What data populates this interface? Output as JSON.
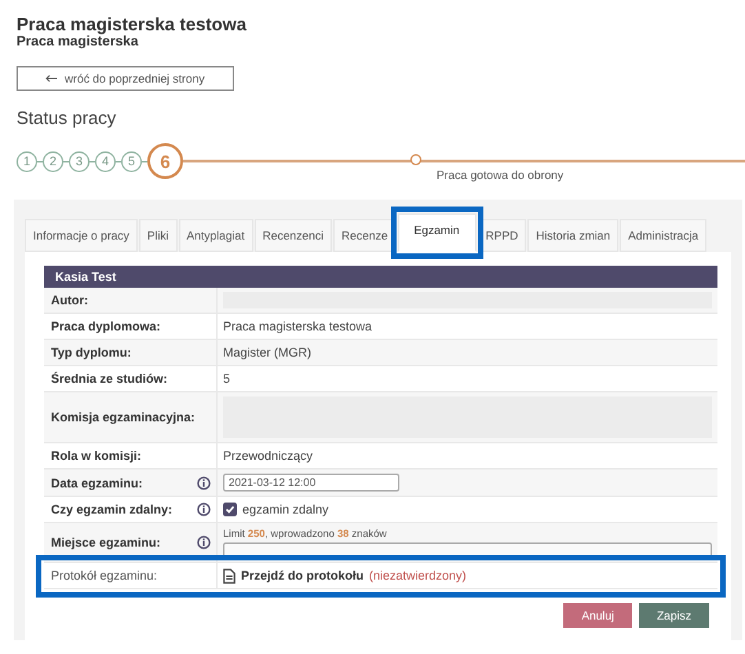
{
  "header": {
    "title": "Praca magisterska testowa",
    "subtitle": "Praca magisterska"
  },
  "back_button": {
    "label": "wróć do poprzedniej strony"
  },
  "status": {
    "heading": "Status pracy",
    "steps": [
      {
        "label": "1",
        "current": false
      },
      {
        "label": "2",
        "current": false
      },
      {
        "label": "3",
        "current": false
      },
      {
        "label": "4",
        "current": false
      },
      {
        "label": "5",
        "current": false
      },
      {
        "label": "6",
        "current": true
      }
    ],
    "milestone": "Praca gotowa do obrony"
  },
  "tabs": [
    {
      "label": "Informacje o pracy",
      "selected": false,
      "highlighted": false
    },
    {
      "label": "Pliki",
      "selected": false,
      "highlighted": false
    },
    {
      "label": "Antyplagiat",
      "selected": false,
      "highlighted": false
    },
    {
      "label": "Recenzenci",
      "selected": false,
      "highlighted": false
    },
    {
      "label": "Recenze",
      "selected": false,
      "highlighted": false
    },
    {
      "label": "Egzamin",
      "selected": true,
      "highlighted": true
    },
    {
      "label": "RPPD",
      "selected": false,
      "highlighted": false
    },
    {
      "label": "Historia zmian",
      "selected": false,
      "highlighted": false
    },
    {
      "label": "Administracja",
      "selected": false,
      "highlighted": false
    }
  ],
  "table": {
    "title": "Kasia Test",
    "rows": [
      {
        "label": "Autor:",
        "kind": "redacted",
        "info": false,
        "highlighted": false
      },
      {
        "label": "Praca dyplomowa:",
        "kind": "text",
        "value": "Praca magisterska testowa",
        "info": false,
        "highlighted": false
      },
      {
        "label": "Typ dyplomu:",
        "kind": "text",
        "value": "Magister (MGR)",
        "info": false,
        "highlighted": false
      },
      {
        "label": "Średnia ze studiów:",
        "kind": "text",
        "value": "5",
        "info": false,
        "highlighted": false
      },
      {
        "label": "Komisja egzaminacyjna:",
        "kind": "redacted_tall",
        "info": false,
        "highlighted": false
      },
      {
        "label": "Rola w komisji:",
        "kind": "text",
        "value": "Przewodniczący",
        "info": false,
        "highlighted": false
      },
      {
        "label": "Data egzaminu:",
        "kind": "input",
        "value": "2021-03-12 12:00",
        "info": true,
        "highlighted": false
      },
      {
        "label": "Czy egzamin zdalny:",
        "kind": "checkbox",
        "value": "egzamin zdalny",
        "checked": true,
        "info": true,
        "highlighted": false
      },
      {
        "label": "Miejsce egzaminu:",
        "kind": "textarea",
        "hint": "Limit **250**, wprowadzono **38** znaków",
        "info": true,
        "highlighted": false
      },
      {
        "label": "Protokół egzaminu:",
        "kind": "link",
        "value": "Przejdź do protokołu",
        "status": "(niezatwierdzony)",
        "info": false,
        "highlighted": true
      }
    ]
  },
  "buttons": [
    {
      "label": "Anuluj",
      "kind": "cancel"
    },
    {
      "label": "Zapisz",
      "kind": "save"
    }
  ]
}
